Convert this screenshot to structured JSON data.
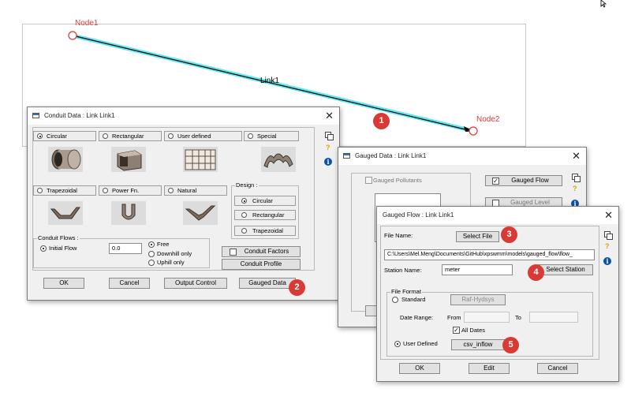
{
  "canvas": {
    "link_label": "Link1",
    "node1_label": "Node1",
    "node2_label": "Node2",
    "node_color": "#e03a3a",
    "link_highlight_color": "#5fe6ee"
  },
  "badges": [
    "1",
    "2",
    "3",
    "4",
    "5"
  ],
  "conduit_dialog": {
    "title": "Conduit Data : Link Link1",
    "shapes": [
      {
        "label": "Circular",
        "selected": true
      },
      {
        "label": "Rectangular",
        "selected": false
      },
      {
        "label": "User defined",
        "selected": false
      },
      {
        "label": "Special",
        "selected": false
      },
      {
        "label": "Trapezoidal",
        "selected": false
      },
      {
        "label": "Power Fn.",
        "selected": false
      },
      {
        "label": "Natural",
        "selected": false
      }
    ],
    "design": {
      "label": "Design :",
      "options": [
        {
          "label": "Circular",
          "selected": true
        },
        {
          "label": "Rectangular",
          "selected": false
        },
        {
          "label": "Trapezoidal",
          "selected": false
        }
      ]
    },
    "conduit_flows": {
      "label": "Conduit Flows :",
      "initial_flow_label": "Initial Flow",
      "initial_flow_value": "0.0",
      "options": [
        {
          "label": "Free",
          "selected": true
        },
        {
          "label": "Downhill only",
          "selected": false
        },
        {
          "label": "Uphill only",
          "selected": false
        }
      ]
    },
    "conduit_factors_label": "Conduit Factors",
    "conduit_profile_label": "Conduit Profile",
    "buttons": {
      "ok": "OK",
      "cancel": "Cancel",
      "output_control": "Output Control",
      "gauged_data": "Gauged Data"
    }
  },
  "gauged_data_dialog": {
    "title": "Gauged Data : Link Link1",
    "gauged_pollutants": "Gauged Pollutants",
    "gauged_flow": "Gauged Flow",
    "gauged_level": "Gauged Level"
  },
  "gauged_flow_dialog": {
    "title": "Gauged Flow : Link Link1",
    "file_name_label": "File Name:",
    "select_file": "Select File",
    "file_path": "C:\\Users\\Mel.Meng\\Documents\\GitHub\\xpswmm\\models\\gauged_flow\\flow_",
    "station_name_label": "Station Name:",
    "station_name_value": "meter",
    "select_station": "Select Station",
    "file_format_label": "File Format",
    "standard_label": "Standard",
    "raf_hydsys": "Raf-Hydsys",
    "date_range_label": "Date Range:",
    "from_label": "From",
    "to_label": "To",
    "all_dates_label": "All Dates",
    "user_defined_label": "User Defined",
    "csv_inflow": "csv_inflow",
    "buttons": {
      "ok": "OK",
      "edit": "Edit",
      "cancel": "Cancel"
    }
  }
}
